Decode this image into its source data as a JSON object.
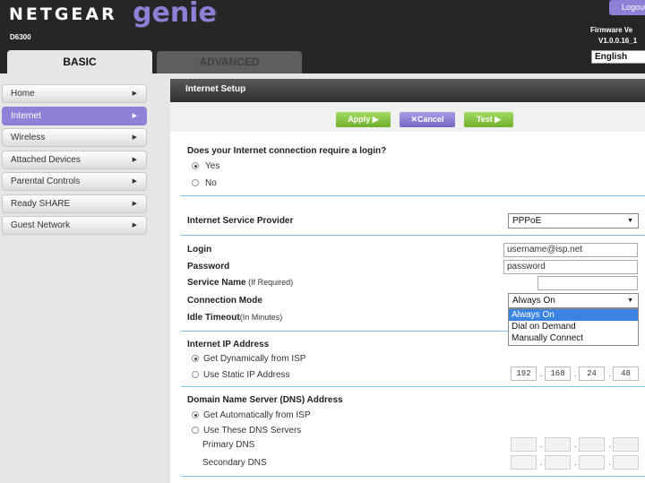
{
  "header": {
    "brand": "NETGEAR",
    "product": "genie",
    "trademark": "®",
    "model": "D6300",
    "logout": "Logout",
    "firmware_label": "Firmware Ve",
    "firmware_version": "V1.0.0.16_1",
    "language": "English"
  },
  "tabs": {
    "basic": "BASIC",
    "advanced": "ADVANCED"
  },
  "sidebar": {
    "arrow": "▶",
    "items": [
      {
        "label": "Home"
      },
      {
        "label": "Internet"
      },
      {
        "label": "Wireless"
      },
      {
        "label": "Attached Devices"
      },
      {
        "label": "Parental Controls"
      },
      {
        "label": "Ready SHARE"
      },
      {
        "label": "Guest Network"
      }
    ]
  },
  "panel": {
    "title": "Internet Setup",
    "buttons": {
      "apply": "Apply ▶",
      "cancel": "✕Cancel",
      "test": "Test ▶"
    },
    "login_question": "Does your Internet connection require a login?",
    "login_options": [
      "Yes",
      "No"
    ],
    "isp_label": "Internet Service Provider",
    "isp_value": "PPPoE",
    "login_label": "Login",
    "login_value": "username@isp.net",
    "password_label": "Password",
    "password_value": "password",
    "service_name_label": "Service Name",
    "service_name_hint": " (If Required)",
    "connection_mode_label": "Connection Mode",
    "connection_mode_value": "Always On",
    "connection_mode_options": [
      "Always On",
      "Dial on Demand",
      "Manually Connect"
    ],
    "idle_timeout_label": "Idle Timeout",
    "idle_timeout_hint": "(In Minutes)",
    "ip_section": "Internet IP Address",
    "ip_options": [
      "Get Dynamically from ISP",
      "Use Static IP Address"
    ],
    "static_ip": [
      "192",
      "168",
      "24",
      "48"
    ],
    "dns_section": "Domain Name Server (DNS) Address",
    "dns_options": [
      "Get Automatically from ISP",
      "Use These DNS Servers"
    ],
    "primary_dns_label": "Primary DNS",
    "secondary_dns_label": "Secondary DNS",
    "select_arrow": "▼",
    "octet_separator": "."
  },
  "colors": {
    "accent": "#8f7fd6",
    "green_button": "#7dbb3a",
    "section_rule": "#7fc4ea",
    "selected_option": "#3b83e0",
    "header_bg": "#262626"
  }
}
